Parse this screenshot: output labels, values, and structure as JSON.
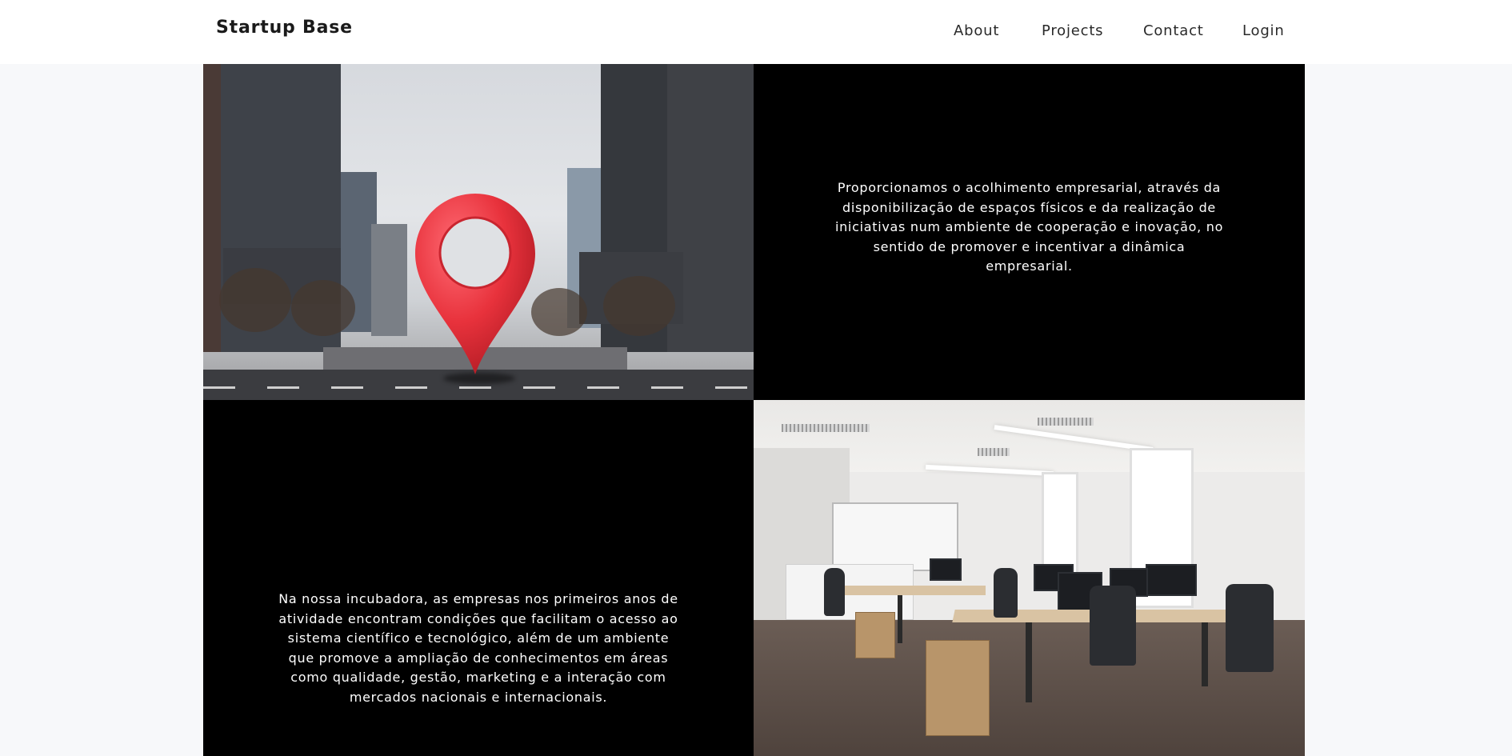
{
  "navbar": {
    "brand": "Startup Base",
    "links": [
      {
        "label": "About"
      },
      {
        "label": "Projects"
      },
      {
        "label": "Contact"
      },
      {
        "label": "Login"
      }
    ]
  },
  "sections": {
    "top_right_text": "Proporcionamos o acolhimento empresarial, através da disponibilização de espaços físicos e da realização de iniciativas num ambiente de cooperação e inovação, no sentido de promover e incentivar a dinâmica empresarial.",
    "bottom_left_text": "Na nossa incubadora, as empresas nos primeiros anos de atividade encontram condições que facilitam o acesso ao sistema científico e tecnológico, além de um ambiente que promove a ampliação de conhecimentos em áreas como qualidade, gestão, marketing e a interação com mercados nacionais e internacionais."
  },
  "images": {
    "city": {
      "icon": "location-pin-icon",
      "pin_color": "#e8323c"
    },
    "office": {
      "subject": "office-workspace"
    }
  },
  "colors": {
    "navbar_bg": "#ffffff",
    "page_bg": "#f7f8fa",
    "text_panel_bg": "#000000",
    "text_panel_fg": "#ffffff"
  }
}
